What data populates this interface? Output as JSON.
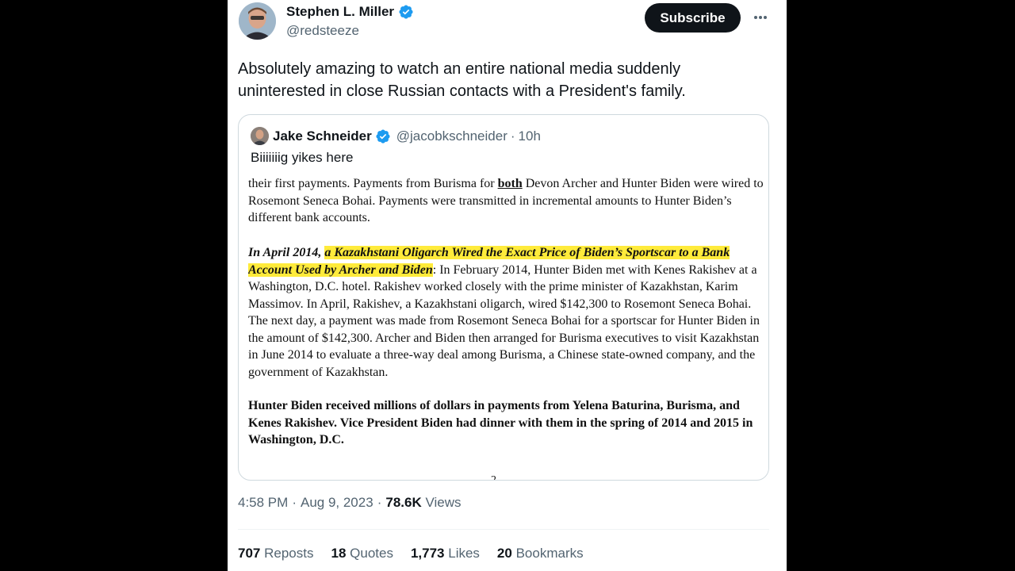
{
  "tweet": {
    "author": {
      "name": "Stephen L. Miller",
      "handle": "@redsteeze"
    },
    "subscribe_label": "Subscribe",
    "text": "Absolutely amazing to watch an entire national media suddenly uninterested in close Russian contacts with a President's family.",
    "time": "4:58 PM",
    "date": "Aug 9, 2023",
    "views_count": "78.6K",
    "views_label": "Views",
    "separator": "·"
  },
  "quote": {
    "author": {
      "name": "Jake Schneider",
      "handle": "@jacobkschneider",
      "age": "10h"
    },
    "text": "Biiiiiiig yikes here",
    "document": {
      "p1_a": "their first payments.  Payments from Burisma for ",
      "p1_b": "both",
      "p1_c": " Devon Archer and Hunter Biden were wired to Rosemont Seneca Bohai.  Payments were transmitted in incremental amounts to Hunter Biden’s different bank accounts.",
      "p2_lead": "In April 2014, ",
      "p2_highlight": "a Kazakhstani Oligarch Wired the Exact Price of Biden’s Sportscar to a Bank Account Used by Archer and Biden",
      "p2_body": ":  In February 2014, Hunter Biden met with Kenes Rakishev at a Washington, D.C. hotel.  Rakishev worked closely with the prime minister of Kazakhstan, Karim Massimov.  In April, Rakishev, a Kazakhstani oligarch, wired $142,300 to Rosemont Seneca Bohai.  The next day, a payment was made from Rosemont Seneca Bohai for a sportscar for Hunter Biden in the amount of $142,300.  Archer and Biden then arranged for Burisma executives to visit Kazakhstan in June 2014 to evaluate a three-way deal among Burisma, a Chinese state-owned company, and the government of Kazakhstan.",
      "p3": "Hunter Biden received millions of dollars in payments from Yelena Baturina, Burisma, and Kenes Rakishev.  Vice President Biden had dinner with them in the spring of 2014 and 2015 in Washington, D.C.",
      "page_number": "2"
    }
  },
  "stats": {
    "reposts": {
      "count": "707",
      "label": "Reposts"
    },
    "quotes": {
      "count": "18",
      "label": "Quotes"
    },
    "likes": {
      "count": "1,773",
      "label": "Likes"
    },
    "bookmarks": {
      "count": "20",
      "label": "Bookmarks"
    }
  },
  "colors": {
    "verified": "#1d9bf0",
    "text_primary": "#0f1419",
    "text_secondary": "#536471",
    "highlight": "#ffeb3b"
  },
  "icons": [
    "verified-badge-icon",
    "more-options-icon"
  ]
}
